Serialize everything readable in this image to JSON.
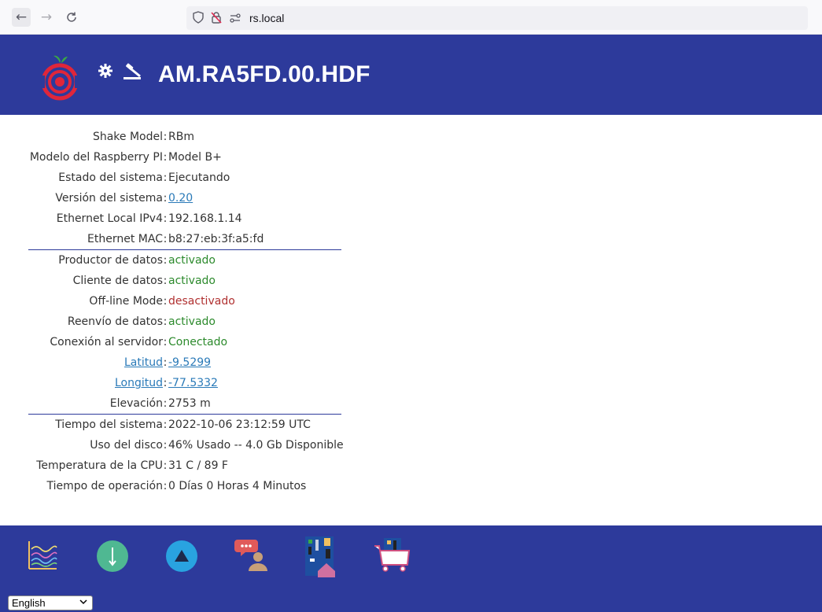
{
  "browser": {
    "url": "rs.local",
    "back_icon": "←",
    "forward_icon": "→",
    "reload_icon": "C"
  },
  "header": {
    "title": "AM.RA5FD.00.HDF",
    "icons": [
      "shake-logo",
      "gear-icon",
      "hammer-icon"
    ]
  },
  "info": {
    "group1": [
      {
        "label": "Shake Model",
        "value": "RBm"
      },
      {
        "label": "Modelo del Raspberry PI",
        "value": "Model B+"
      },
      {
        "label": "Estado del sistema",
        "value": "Ejecutando"
      },
      {
        "label": "Versión del sistema",
        "value": "0.20"
      },
      {
        "label": "Ethernet Local IPv4",
        "value": "192.168.1.14"
      },
      {
        "label": "Ethernet MAC",
        "value": "b8:27:eb:3f:a5:fd"
      }
    ],
    "group2": [
      {
        "label": "Productor de datos",
        "value": "activado"
      },
      {
        "label": "Cliente de datos",
        "value": "activado"
      },
      {
        "label": "Off-line Mode",
        "value": "desactivado"
      },
      {
        "label": "Reenvío de datos",
        "value": "activado"
      },
      {
        "label": "Conexión al servidor",
        "value": "Conectado"
      },
      {
        "label": "Latitud",
        "value": "-9.5299"
      },
      {
        "label": "Longitud",
        "value": "-77.5332"
      },
      {
        "label": "Elevación",
        "value": "2753 m"
      }
    ],
    "group3": [
      {
        "label": "Tiempo del sistema",
        "value": "2022-10-06 23:12:59 UTC"
      },
      {
        "label": "Uso del disco",
        "value": "46% Usado -- 4.0 Gb Disponible"
      },
      {
        "label": "Temperatura de la CPU",
        "value": "31 C / 89 F"
      },
      {
        "label": "Tiempo de operación",
        "value": "0 Días 0 Horas 4 Minutos"
      }
    ]
  },
  "colors": {
    "header_bg": "#2d3a9b",
    "active": "#2c8a2c",
    "inactive": "#b03030",
    "link": "#2a7ab8"
  },
  "footer": {
    "icons": [
      "helicorder-icon",
      "download-icon",
      "upload-icon",
      "support-chat-icon",
      "home-board-icon",
      "shop-cart-icon"
    ],
    "language": "English"
  }
}
